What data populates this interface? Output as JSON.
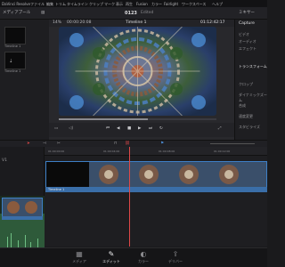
{
  "menu": {
    "items": [
      "DaVinci Resolve",
      "ファイル",
      "編集",
      "トリム",
      "タイムライン",
      "クリップ",
      "マーク",
      "表示",
      "再生",
      "Fusion",
      "カラー",
      "Fairlight",
      "ワークスペース",
      "ヘルプ"
    ]
  },
  "toolbar": {
    "left_label": "メディアプール",
    "project_title": "0123",
    "edit_label": "Edited",
    "right_label": "ミキサー"
  },
  "pool": {
    "thumb1_label": "Timeline 1",
    "thumb2_label": "Timeline 1"
  },
  "viewer": {
    "zoom": "14%",
    "timecode_left": "00:00:20:08",
    "clip_name": "Timeline 1",
    "timecode_right": "01:12:42:17"
  },
  "inspector": {
    "title": "Capture",
    "rows": [
      "ビデオ",
      "オーディオ",
      "エフェクト",
      "トランスフォーム",
      "クロップ",
      "ダイナミックズーム",
      "合成",
      "速度変更",
      "スタビライズ"
    ]
  },
  "timeline": {
    "tracks": [
      "V1",
      "A1"
    ],
    "clip_name": "Timeline 1",
    "ruler_ticks": [
      "01:00:00:00",
      "01:00:04:00",
      "01:00:08:00",
      "01:00:12:00"
    ]
  },
  "pages": [
    {
      "label": "メディア",
      "icon": "▦"
    },
    {
      "label": "エディット",
      "icon": "✎"
    },
    {
      "label": "カラー",
      "icon": "◐"
    },
    {
      "label": "デリバー",
      "icon": "⇪"
    }
  ],
  "colors": {
    "accent": "#3d7fc6",
    "playhead": "#e04848",
    "audio": "#2e5a3a"
  }
}
